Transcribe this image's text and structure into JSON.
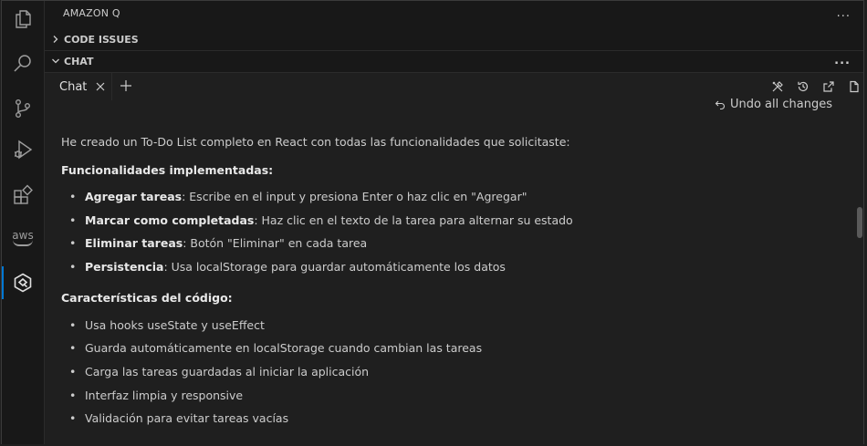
{
  "activity_bar": {
    "items": [
      {
        "name": "explorer-icon"
      },
      {
        "name": "search-icon"
      },
      {
        "name": "source-control-icon"
      },
      {
        "name": "run-debug-icon"
      },
      {
        "name": "extensions-icon"
      },
      {
        "name": "aws-icon",
        "label": "aws"
      },
      {
        "name": "amazon-q-icon",
        "active": true
      }
    ]
  },
  "sidebar": {
    "view_title": "AMAZON Q",
    "view_more": "...",
    "sections": [
      {
        "label": "CODE ISSUES",
        "expanded": false
      },
      {
        "label": "CHAT",
        "expanded": true,
        "more": "..."
      }
    ]
  },
  "chat_tabs": {
    "tabs": [
      {
        "label": "Chat",
        "active": true
      }
    ],
    "toolbar_icons": [
      "tools-icon",
      "history-icon",
      "open-external-icon",
      "new-file-icon"
    ]
  },
  "chat": {
    "undo_label": "Undo all changes",
    "intro": "He creado un To-Do List completo en React con todas las funcionalidades que solicitaste:",
    "features_heading": "Funcionalidades implementadas:",
    "features": [
      {
        "bold": "Agregar tareas",
        "text": ": Escribe en el input y presiona Enter o haz clic en \"Agregar\""
      },
      {
        "bold": "Marcar como completadas",
        "text": ": Haz clic en el texto de la tarea para alternar su estado"
      },
      {
        "bold": "Eliminar tareas",
        "text": ": Botón \"Eliminar\" en cada tarea"
      },
      {
        "bold": "Persistencia",
        "text": ": Usa localStorage para guardar automáticamente los datos"
      }
    ],
    "code_heading": "Características del código:",
    "code_items": [
      "Usa hooks useState y useEffect",
      "Guarda automáticamente en localStorage cuando cambian las tareas",
      "Carga las tareas guardadas al iniciar la aplicación",
      "Interfaz limpia y responsive",
      "Validación para evitar tareas vacías"
    ]
  },
  "colors": {
    "background": "#1f1f1f",
    "activity_bar": "#181818",
    "accent": "#0078d4",
    "text": "#cccccc"
  }
}
